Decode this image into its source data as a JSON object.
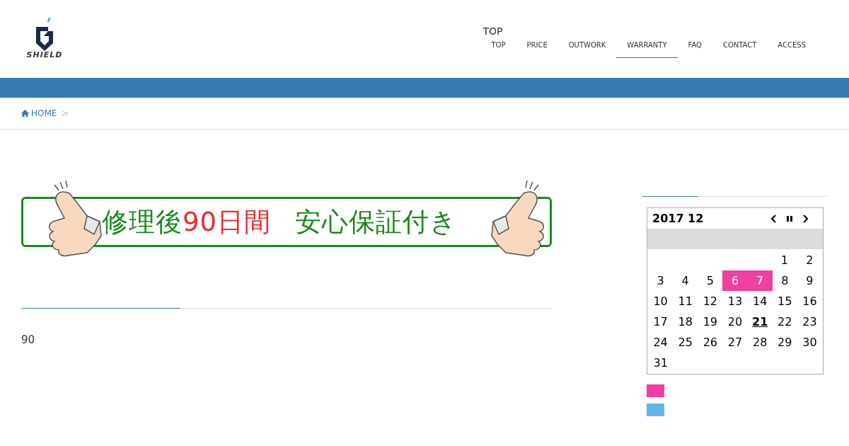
{
  "logo": {
    "text": "SHIELD"
  },
  "nav": {
    "caption": "TOP",
    "items": [
      {
        "label": "TOP",
        "selected": false
      },
      {
        "label": "PRICE",
        "selected": false
      },
      {
        "label": "OUTWORK",
        "selected": false
      },
      {
        "label": "WARRANTY",
        "selected": true
      },
      {
        "label": "FAQ",
        "selected": false
      },
      {
        "label": "CONTACT",
        "selected": false
      },
      {
        "label": "ACCESS",
        "selected": false
      }
    ]
  },
  "breadcrumb": {
    "home": "HOME",
    "separator": ">"
  },
  "banner": {
    "segments": [
      {
        "text": "修理後",
        "kind": "normal"
      },
      {
        "text": "90日間",
        "kind": "accent"
      },
      {
        "text": "安心保証付き",
        "kind": "normal"
      }
    ]
  },
  "body_text": "90",
  "calendar": {
    "title": "2017 12",
    "weeks": [
      {
        "right_aligned": true,
        "days": [
          {
            "day": "1",
            "holiday": false,
            "today": false
          },
          {
            "day": "2",
            "holiday": false,
            "today": false
          }
        ]
      },
      {
        "days": [
          {
            "day": "3",
            "holiday": false,
            "today": false
          },
          {
            "day": "4",
            "holiday": false,
            "today": false
          },
          {
            "day": "5",
            "holiday": false,
            "today": false
          },
          {
            "day": "6",
            "holiday": true,
            "today": false
          },
          {
            "day": "7",
            "holiday": true,
            "today": false
          },
          {
            "day": "8",
            "holiday": false,
            "today": false
          },
          {
            "day": "9",
            "holiday": false,
            "today": false
          }
        ]
      },
      {
        "days": [
          {
            "day": "10",
            "holiday": false,
            "today": false
          },
          {
            "day": "11",
            "holiday": false,
            "today": false
          },
          {
            "day": "12",
            "holiday": false,
            "today": false
          },
          {
            "day": "13",
            "holiday": false,
            "today": false
          },
          {
            "day": "14",
            "holiday": false,
            "today": false
          },
          {
            "day": "15",
            "holiday": false,
            "today": false
          },
          {
            "day": "16",
            "holiday": false,
            "today": false
          }
        ]
      },
      {
        "days": [
          {
            "day": "17",
            "holiday": false,
            "today": false
          },
          {
            "day": "18",
            "holiday": false,
            "today": false
          },
          {
            "day": "19",
            "holiday": false,
            "today": false
          },
          {
            "day": "20",
            "holiday": false,
            "today": false
          },
          {
            "day": "21",
            "holiday": false,
            "today": true
          },
          {
            "day": "22",
            "holiday": false,
            "today": false
          },
          {
            "day": "23",
            "holiday": false,
            "today": false
          }
        ]
      },
      {
        "days": [
          {
            "day": "24",
            "holiday": false,
            "today": false
          },
          {
            "day": "25",
            "holiday": false,
            "today": false
          },
          {
            "day": "26",
            "holiday": false,
            "today": false
          },
          {
            "day": "27",
            "holiday": false,
            "today": false
          },
          {
            "day": "28",
            "holiday": false,
            "today": false
          },
          {
            "day": "29",
            "holiday": false,
            "today": false
          },
          {
            "day": "30",
            "holiday": false,
            "today": false
          }
        ]
      },
      {
        "right_aligned": false,
        "days": [
          {
            "day": "31",
            "holiday": false,
            "today": false
          }
        ]
      }
    ]
  },
  "legend": [
    {
      "color": "#f23ea0"
    },
    {
      "color": "#63b5e6"
    }
  ]
}
